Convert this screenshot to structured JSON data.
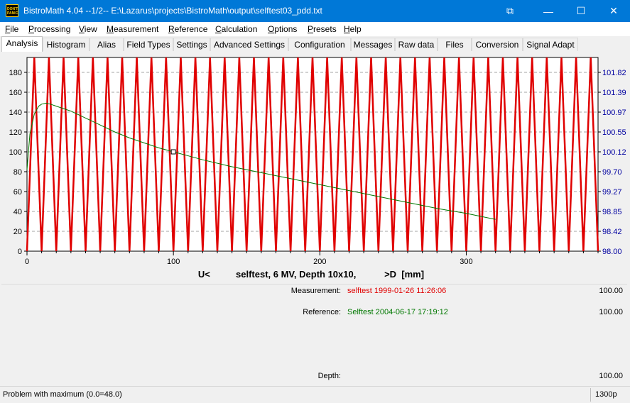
{
  "window": {
    "title": "BistroMath 4.04 --1/2-- E:\\Lazarus\\projects\\BistroMath\\output\\selftest03_pdd.txt",
    "icon": "dont-panic-app-icon",
    "controls": {
      "restore": "⧉",
      "minimize": "—",
      "maximize": "☐",
      "close": "✕"
    }
  },
  "menu": [
    {
      "label": "File",
      "key": "F",
      "rest": "ile"
    },
    {
      "label": "Processing",
      "key": "P",
      "rest": "rocessing"
    },
    {
      "label": "View",
      "key": "V",
      "rest": "iew"
    },
    {
      "label": "Measurement",
      "key": "M",
      "rest": "easurement"
    },
    {
      "label": "Reference",
      "key": "R",
      "rest": "eference"
    },
    {
      "label": "Calculation",
      "key": "C",
      "rest": "alculation"
    },
    {
      "label": "Options",
      "key": "O",
      "rest": "ptions"
    },
    {
      "label": "Presets",
      "key": "P",
      "rest": "resets"
    },
    {
      "label": "Help",
      "key": "H",
      "rest": "elp"
    }
  ],
  "tabs": [
    "Analysis",
    "Histogram",
    "Alias",
    "Field Types",
    "Settings",
    "Advanced Settings",
    "Configuration",
    "Messages",
    "Raw data",
    "Files",
    "Conversion",
    "Signal Adapt"
  ],
  "active_tab": "Analysis",
  "chart_data": {
    "type": "line",
    "title": "U<          selftest, 6 MV, Depth 10x10,           >D  [mm]",
    "xlabel": "",
    "xlim": [
      0,
      390
    ],
    "ylim": [
      0,
      195
    ],
    "xticks": [
      0,
      100,
      200,
      300
    ],
    "yticks": [
      0,
      20,
      40,
      60,
      80,
      100,
      120,
      140,
      160,
      180
    ],
    "y2ticks": [
      "98.00",
      "98.42",
      "98.85",
      "99.27",
      "99.70",
      "100.12",
      "100.55",
      "100.97",
      "101.39",
      "101.82"
    ],
    "grid": true,
    "colors": {
      "measurement": "#e00000",
      "reference": "#007800",
      "right_axis": "#0000a0"
    },
    "series": [
      {
        "name": "Measurement",
        "note_sawtooth_period": 10,
        "sawtooth": {
          "period": 10,
          "min": 0,
          "max": 200,
          "rise": 0.5
        }
      },
      {
        "name": "Reference",
        "x": [
          0,
          2,
          5,
          8,
          10,
          13,
          16,
          20,
          30,
          40,
          50,
          60,
          70,
          80,
          90,
          100,
          120,
          140,
          160,
          180,
          200,
          220,
          240,
          260,
          280,
          300,
          320
        ],
        "y": [
          82,
          118,
          138,
          146,
          148,
          149,
          148,
          146,
          141,
          134,
          127,
          120,
          114,
          109,
          104,
          100,
          92,
          85,
          79,
          73,
          67,
          61,
          55,
          49,
          43,
          38,
          32
        ]
      }
    ],
    "marker": {
      "x": 100,
      "y": 100
    }
  },
  "info": {
    "measurement_label": "Measurement:",
    "measurement_value": "selftest 1999-01-26 11:26:06",
    "measurement_number": "100.00",
    "reference_label": "Reference:",
    "reference_value": "Selftest 2004-06-17 17:19:12",
    "reference_number": "100.00",
    "depth_label": "Depth:",
    "depth_number": "100.00"
  },
  "status": {
    "message": "Problem with maximum (0.0=48.0)",
    "right": "1300p"
  }
}
